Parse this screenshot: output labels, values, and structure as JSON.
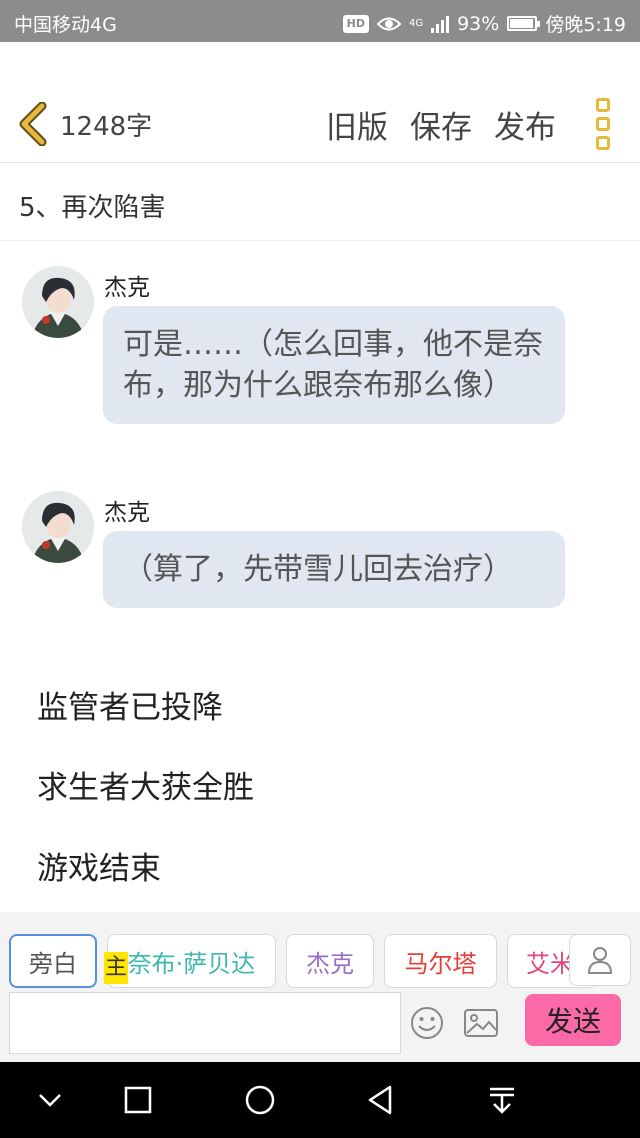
{
  "status_bar": {
    "carrier": "中国移动4G",
    "hd": "HD",
    "network": "4G",
    "battery": "93%",
    "battery_level": 0.93,
    "time": "傍晚5:19"
  },
  "toolbar": {
    "word_count": "1248字",
    "old_version": "旧版",
    "save": "保存",
    "publish": "发布",
    "accent_color": "#e7b93b"
  },
  "chapter": {
    "title": "5、再次陷害"
  },
  "messages": [
    {
      "speaker": "杰克",
      "text": "可是……（怎么回事，他不是奈布，那为什么跟奈布那么像）"
    },
    {
      "speaker": "杰克",
      "text": "（算了，先带雪儿回去治疗）"
    }
  ],
  "narration": [
    "监管者已投降",
    "求生者大获全胜",
    "游戏结束"
  ],
  "composer": {
    "chips": [
      {
        "label": "旁白",
        "color": "#555555"
      },
      {
        "label": "奈布·萨贝达",
        "color": "#3cb8b0"
      },
      {
        "label": "杰克",
        "color": "#9b6fc7"
      },
      {
        "label": "马尔塔",
        "color": "#e2403b"
      },
      {
        "label": "艾米",
        "color": "#e0487a"
      }
    ],
    "host_badge": "主",
    "input_value": "",
    "send_label": "发送",
    "send_color": "#fb6aa6"
  },
  "icons": {
    "back": "chevron-left-icon",
    "menu": "more-vertical-icon",
    "emoji": "smile-icon",
    "image": "image-icon",
    "person": "person-icon",
    "nav": [
      "chevron-down-icon",
      "square-icon",
      "circle-icon",
      "triangle-back-icon",
      "download-icon"
    ]
  }
}
